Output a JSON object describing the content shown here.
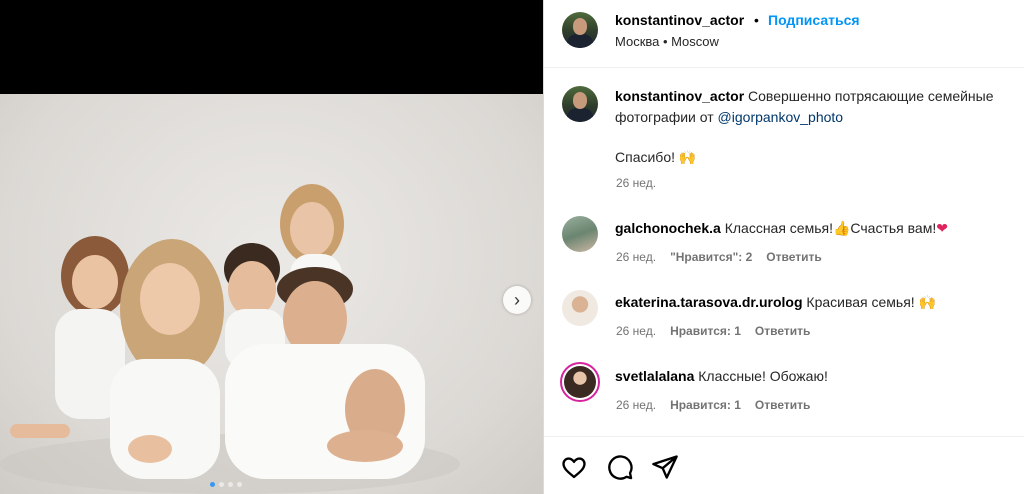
{
  "post": {
    "username": "konstantinov_actor",
    "separator": "•",
    "follow_label": "Подписаться",
    "location": "Москва • Moscow",
    "caption_text": "Совершенно потрясающие семейные фотографии от ",
    "caption_mention": "@igorpankov_photo",
    "caption_line2": "Спасибо! ",
    "caption_time": "26 нед."
  },
  "media": {
    "next_icon": "chevron-right-icon",
    "carousel_pages": 4,
    "carousel_active": 1
  },
  "comments": [
    {
      "username": "galchonochek.a",
      "text": "Классная семья!",
      "text2": "Счастья вам!",
      "time": "26 нед.",
      "likes": "\"Нравится\": 2",
      "reply": "Ответить"
    },
    {
      "username": "ekaterina.tarasova.dr.urolog",
      "text": "Красивая семья! ",
      "time": "26 нед.",
      "likes": "Нравится: 1",
      "reply": "Ответить"
    },
    {
      "username": "svetlalalana",
      "text": "Классные! Обожаю!",
      "time": "26 нед.",
      "likes": "Нравится: 1",
      "reply": "Ответить"
    }
  ],
  "actions": {
    "like_icon": "heart-icon",
    "comment_icon": "comment-icon",
    "share_icon": "share-icon"
  },
  "colors": {
    "follow": "#0095f6",
    "mention": "#00376b",
    "meta": "#737373"
  }
}
